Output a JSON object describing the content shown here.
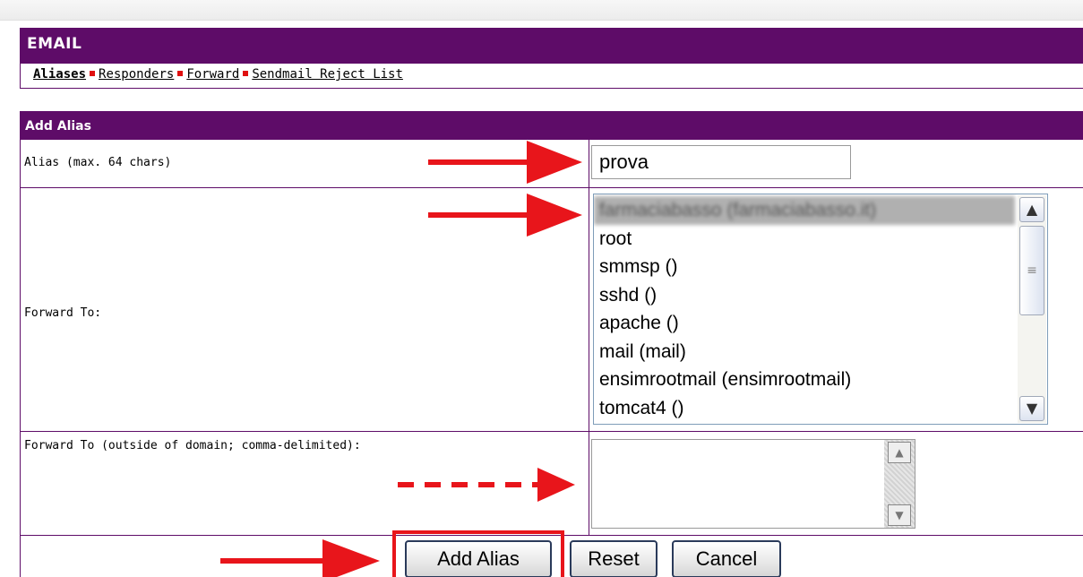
{
  "section": {
    "title": "EMAIL"
  },
  "subnav": {
    "items": [
      "Aliases",
      "Responders",
      "Forward",
      "Sendmail Reject List"
    ]
  },
  "form": {
    "title": "Add Alias",
    "alias_label": "Alias (max. 64 chars)",
    "alias_value": "prova",
    "forward_to_label": "Forward To:",
    "forward_options": [
      "farmaciabasso (farmaciabasso.it)",
      "root",
      "smmsp ()",
      "sshd ()",
      "apache ()",
      "mail (mail)",
      "ensimrootmail (ensimrootmail)",
      "tomcat4 ()"
    ],
    "outside_label": "Forward To (outside of domain; comma-delimited):",
    "outside_value": ""
  },
  "buttons": {
    "add": "Add Alias",
    "reset": "Reset",
    "cancel": "Cancel"
  },
  "colors": {
    "header_bg": "#5e0c68",
    "separator": "#e01010",
    "arrow": "#e8151b"
  },
  "icons": {
    "scroll_up": "▲",
    "scroll_down": "▼",
    "grip": "≡"
  }
}
